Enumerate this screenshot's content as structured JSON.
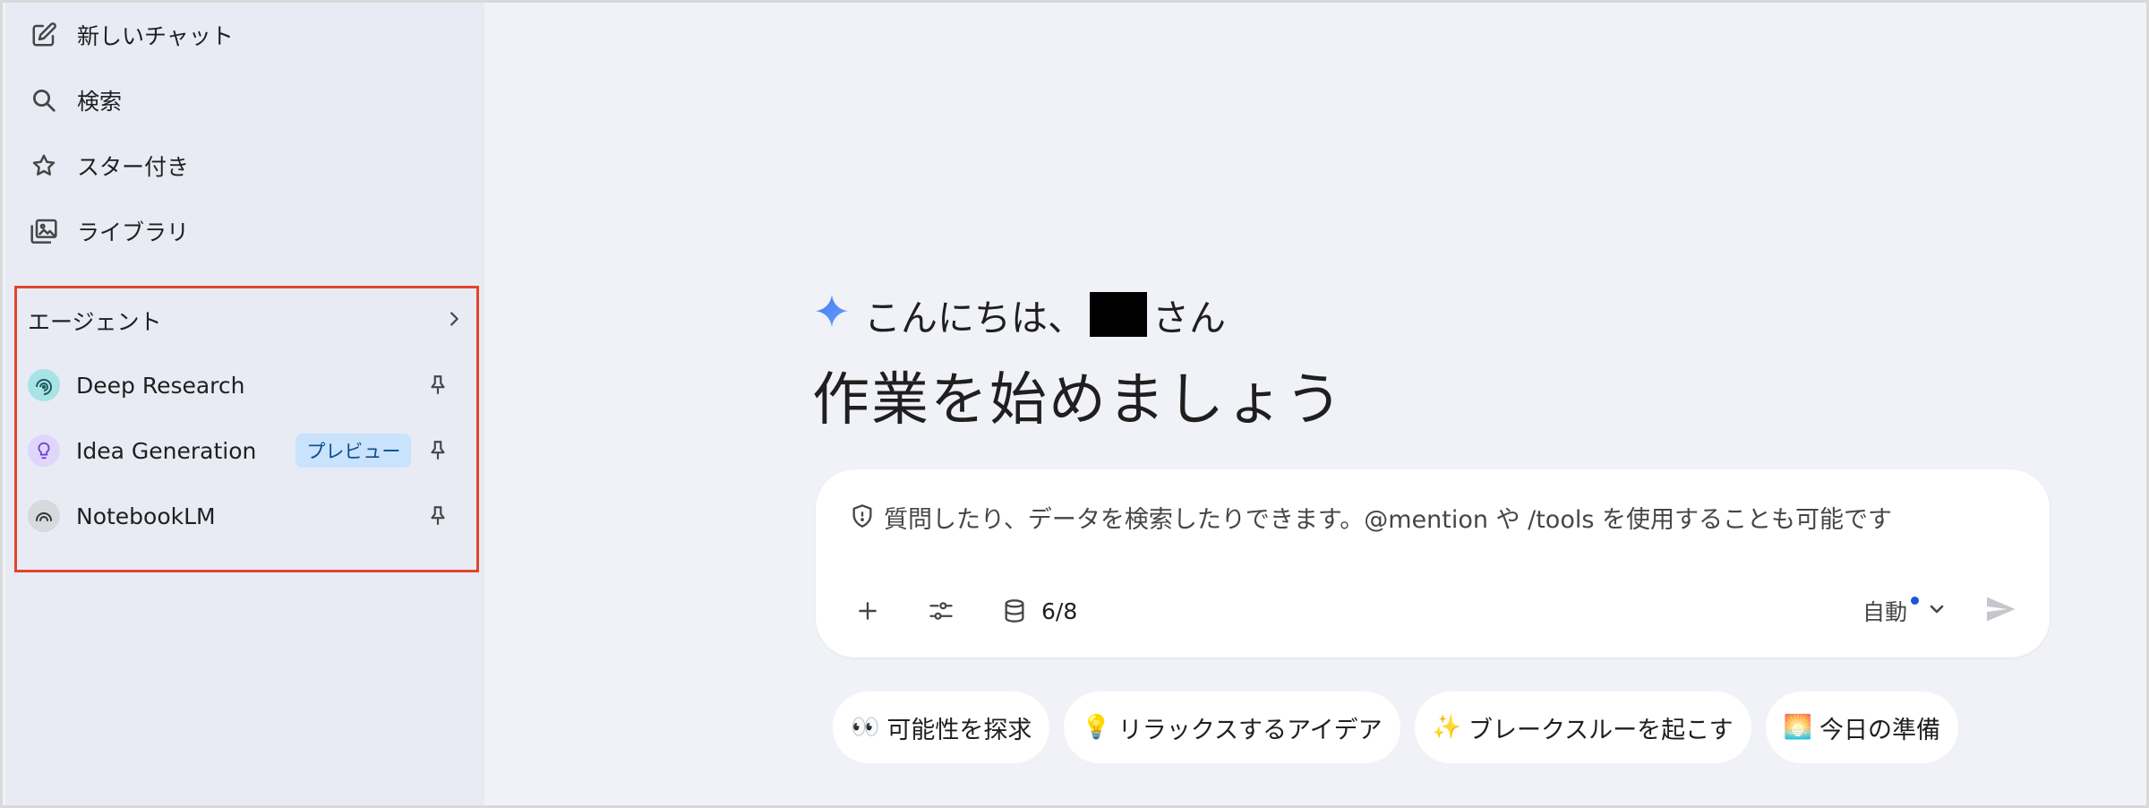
{
  "sidebar": {
    "nav": [
      {
        "label": "新しいチャット",
        "icon": "edit-icon"
      },
      {
        "label": "検索",
        "icon": "search-icon"
      },
      {
        "label": "スター付き",
        "icon": "star-icon"
      },
      {
        "label": "ライブラリ",
        "icon": "library-icon"
      }
    ],
    "agents": {
      "title": "エージェント",
      "items": [
        {
          "name": "Deep Research",
          "icon": "deep-research-icon",
          "badge": ""
        },
        {
          "name": "Idea Generation",
          "icon": "bulb-icon",
          "badge": "プレビュー"
        },
        {
          "name": "NotebookLM",
          "icon": "notebooklm-icon",
          "badge": ""
        }
      ]
    }
  },
  "main": {
    "greeting_prefix": "こんにちは、",
    "greeting_suffix": "さん",
    "headline": "作業を始めましょう",
    "composer": {
      "placeholder": "質問したり、データを検索したりできます。@mention や /tools を使用することも可能です",
      "source_count": "6/8",
      "mode": "自動"
    },
    "chips": [
      {
        "emoji": "👀",
        "label": "可能性を探求"
      },
      {
        "emoji": "💡",
        "label": "リラックスするアイデア"
      },
      {
        "emoji": "✨",
        "label": "ブレークスルーを起こす"
      },
      {
        "emoji": "🌅",
        "label": "今日の準備"
      }
    ]
  },
  "colors": {
    "sidebar_bg": "#e8ebf4",
    "main_bg": "#f0f2f8",
    "highlight_border": "#e2452d",
    "badge_bg": "#c8e3fb",
    "gemini_spark": "#4a7cf6"
  }
}
